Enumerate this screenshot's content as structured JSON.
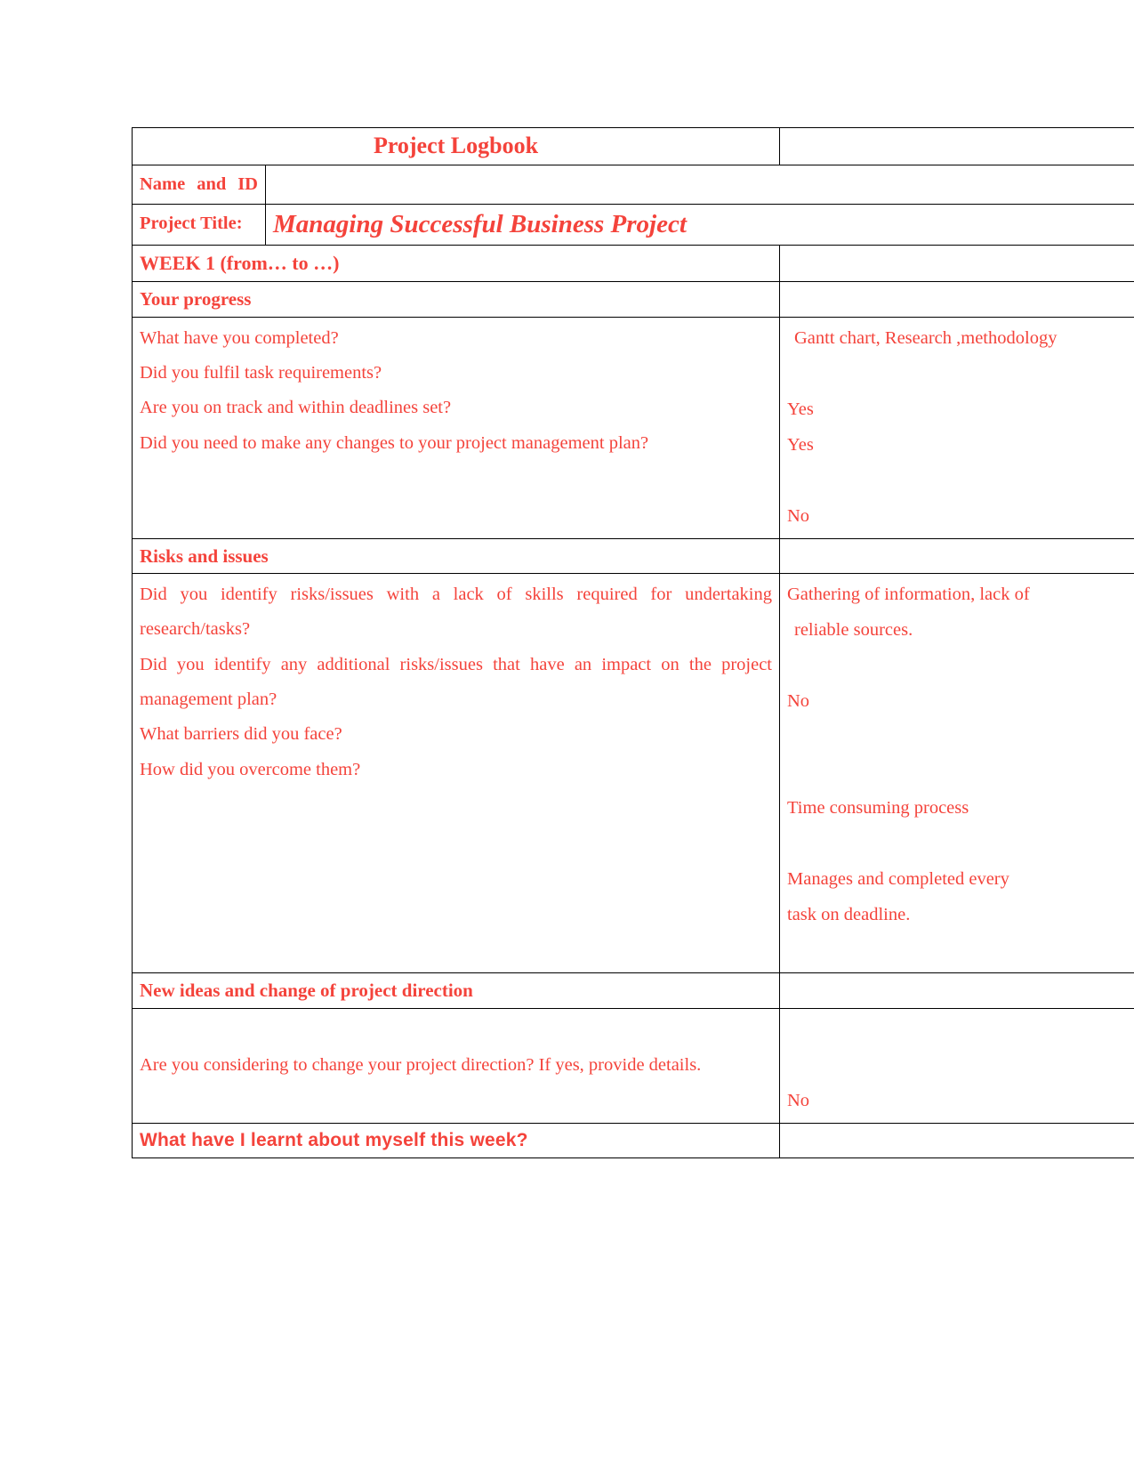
{
  "document": {
    "title": "Project Logbook",
    "text_color": "#F4433B",
    "shade_color": "#BFBFBF",
    "border_color": "#000000",
    "page_background": "#FFFFFF"
  },
  "header": {
    "title": "Project Logbook",
    "name_and_id_label": "Name and ID",
    "name_and_id_value": "",
    "project_title_label": "Project Title:",
    "project_title_value": "Managing Successful Business Project"
  },
  "week": {
    "heading": "WEEK 1 (from… to …)",
    "heading_answer": ""
  },
  "sections": [
    {
      "heading": "Your progress",
      "heading_answer": "",
      "questions": [
        "What have you completed?",
        "Did you fulfil task requirements?",
        "Are you on track and within deadlines set?",
        "Did you need to make any changes to your project management plan?"
      ],
      "answers": [
        "Gantt chart, Research ,methodology",
        "Yes",
        "Yes",
        "No"
      ]
    },
    {
      "heading": "Risks and issues",
      "heading_answer": "",
      "questions": [
        "Did you identify risks/issues with a lack of skills required for undertaking research/tasks?",
        "Did you identify any additional risks/issues that have an impact on the project management plan?",
        "What barriers did you face?",
        "How did you overcome them?"
      ],
      "answers": [
        "Gathering of information, lack of",
        "reliable sources.",
        "No",
        "Time consuming process",
        "Manages and completed every",
        "task on deadline."
      ]
    },
    {
      "heading": "New ideas and change of project direction",
      "heading_answer": "",
      "questions": [
        "Are you considering to change your project direction? If yes, provide details."
      ],
      "answers": [
        "No"
      ]
    },
    {
      "heading": "What have I learnt about myself this week?",
      "heading_answer": "",
      "questions": [],
      "answers": []
    }
  ]
}
